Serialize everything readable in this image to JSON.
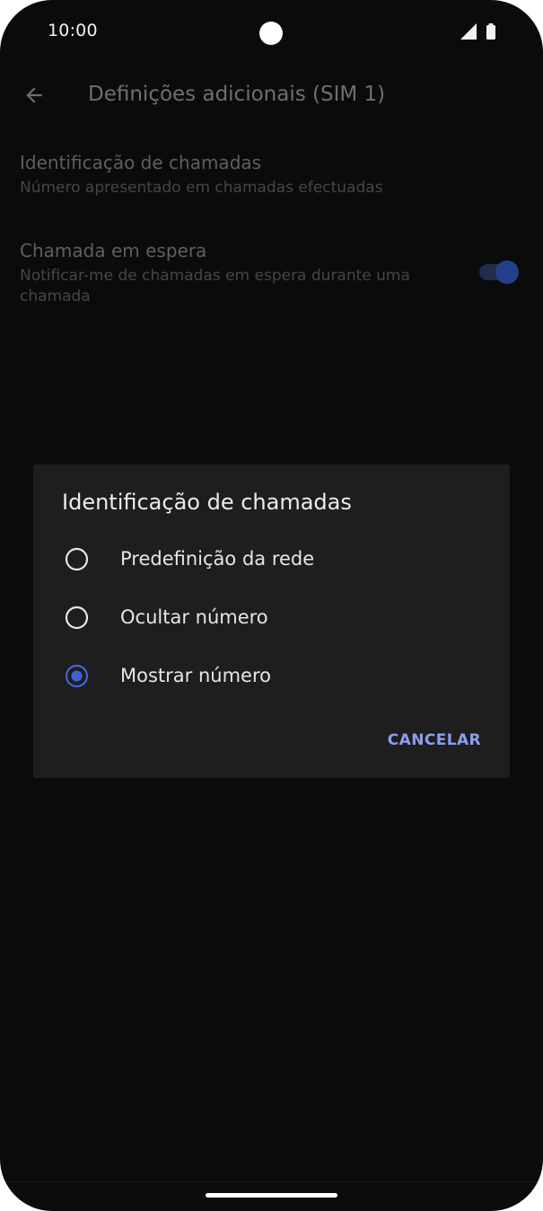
{
  "status_bar": {
    "time": "10:00",
    "icons": [
      "signal-icon",
      "battery-icon"
    ]
  },
  "app_bar": {
    "back_icon": "arrow-left-icon",
    "title": "Definições adicionais (SIM 1)"
  },
  "settings": [
    {
      "title": "Identificação de chamadas",
      "subtitle": "Número apresentado em chamadas efectuadas"
    },
    {
      "title": "Chamada em espera",
      "subtitle": "Notificar-me de chamadas em espera durante uma chamada",
      "toggle_on": true
    }
  ],
  "dialog": {
    "title": "Identificação de chamadas",
    "options": [
      {
        "label": "Predefinição da rede",
        "selected": false
      },
      {
        "label": "Ocultar número",
        "selected": false
      },
      {
        "label": "Mostrar número",
        "selected": true
      }
    ],
    "cancel_label": "CANCELAR"
  },
  "colors": {
    "accent": "#3d63d6",
    "button_text": "#8c9ef0",
    "background": "#0b0b0c",
    "dialog": "#1e1e1f"
  }
}
